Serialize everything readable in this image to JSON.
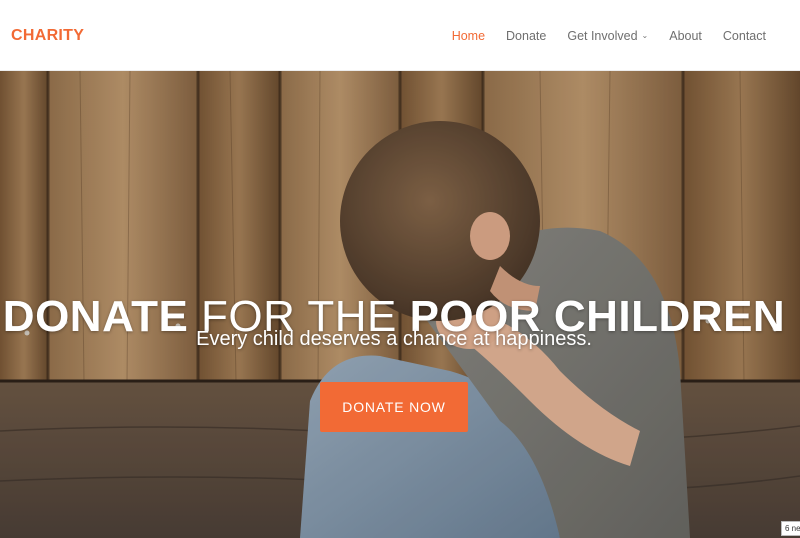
{
  "header": {
    "brand": "CHARITY",
    "nav": [
      {
        "label": "Home",
        "active": true
      },
      {
        "label": "Donate"
      },
      {
        "label": "Get Involved",
        "has_dropdown": true
      },
      {
        "label": "About"
      },
      {
        "label": "Contact"
      }
    ]
  },
  "hero": {
    "title_part1": "DONATE",
    "title_part2": " FOR THE ",
    "title_part3": "POOR CHILDREN",
    "subtitle": "Every child deserves a chance at happiness.",
    "cta_label": "DONATE NOW",
    "corner_badge": "6 ne",
    "image": "child-sitting-against-wooden-wall"
  },
  "colors": {
    "accent": "#f26a35",
    "nav_text": "#6f6f6f"
  }
}
